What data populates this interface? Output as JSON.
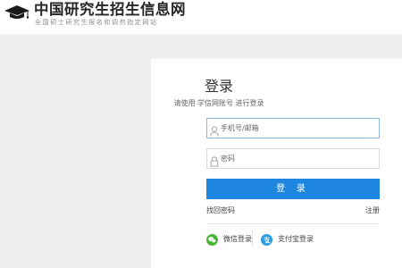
{
  "header": {
    "title": "中国研究生招生信息网",
    "subtitle": "全国硕士研究生报名和调剂指定网站"
  },
  "login": {
    "title": "登录",
    "hint": "请使用 学信网账号 进行登录",
    "account_placeholder": "手机号/邮箱",
    "password_placeholder": "密码",
    "submit_label": "登 录",
    "forgot_label": "找回密码",
    "register_label": "注册",
    "wechat_label": "微信登录",
    "alipay_label": "支付宝登录"
  },
  "colors": {
    "primary": "#1f86e0",
    "wechat": "#4ab534",
    "alipay": "#2a9ee5",
    "background": "#eeeff1"
  },
  "icons": {
    "logo": "graduation-cap-icon",
    "account": "user-icon",
    "password": "lock-icon",
    "wechat": "wechat-icon",
    "alipay": "alipay-icon"
  }
}
